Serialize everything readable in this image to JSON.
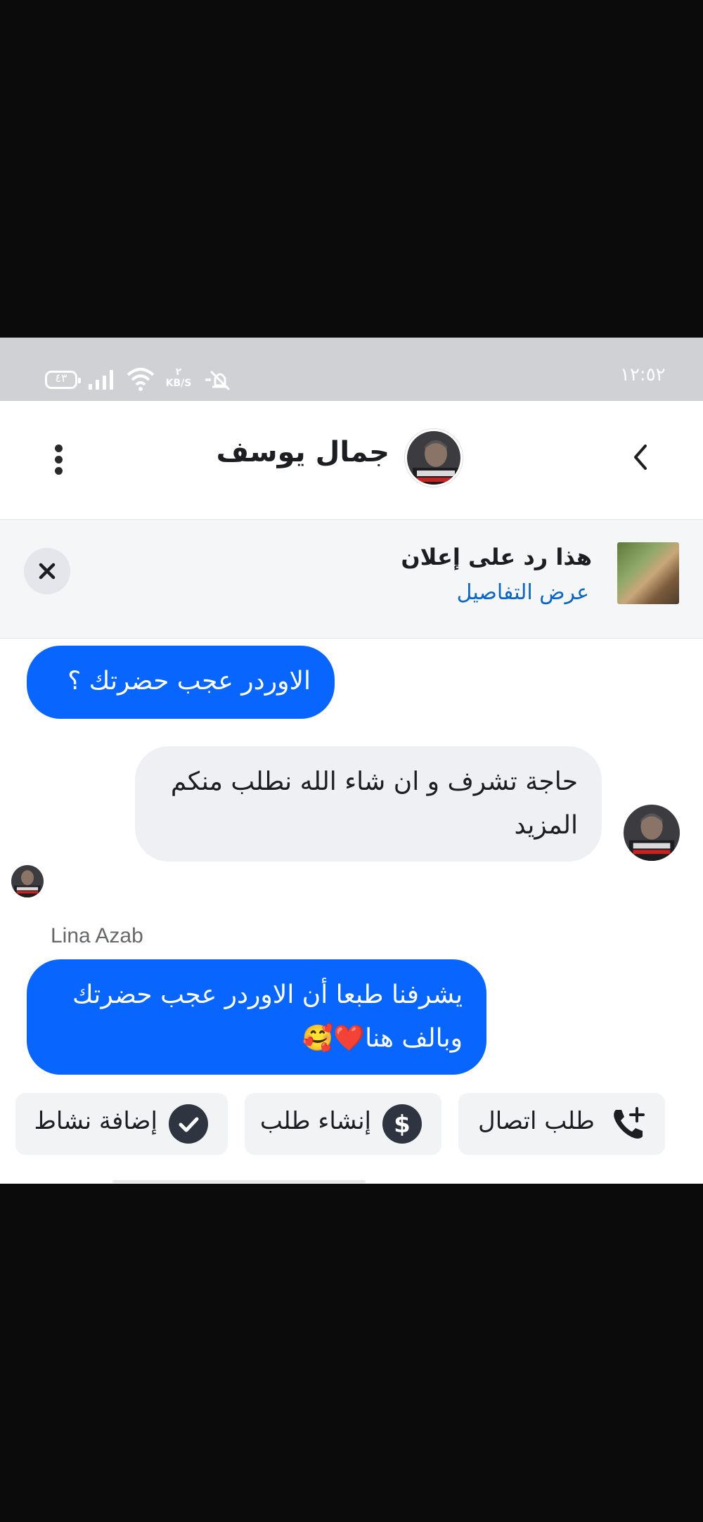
{
  "status_bar": {
    "time": "١٢:٥٢",
    "battery": "٤٣",
    "speed_value": "٢",
    "speed_unit": "KB/S"
  },
  "header": {
    "contact_name": "جمال يوسف"
  },
  "ad_banner": {
    "title": "هذا رد على إعلان",
    "link": "عرض التفاصيل"
  },
  "messages": [
    {
      "direction": "outgoing",
      "text": "الاوردر عجب حضرتك ؟"
    },
    {
      "direction": "incoming",
      "text": "حاجة تشرف و ان شاء الله نطلب منكم المزيد"
    },
    {
      "direction": "outgoing",
      "sender": "Lina Azab",
      "text": "يشرفنا طبعا أن الاوردر عجب حضرتك وبالف هنا❤️🥰"
    }
  ],
  "quick_actions": [
    {
      "label": "طلب اتصال",
      "icon": "phone-plus-icon"
    },
    {
      "label": "إنشاء طلب",
      "icon": "dollar-icon"
    },
    {
      "label": "إضافة نشاط",
      "icon": "check-circle-icon"
    }
  ],
  "colors": {
    "accent": "#0866ff",
    "link": "#0a66c2",
    "incoming_bubble": "#eef0f3"
  }
}
